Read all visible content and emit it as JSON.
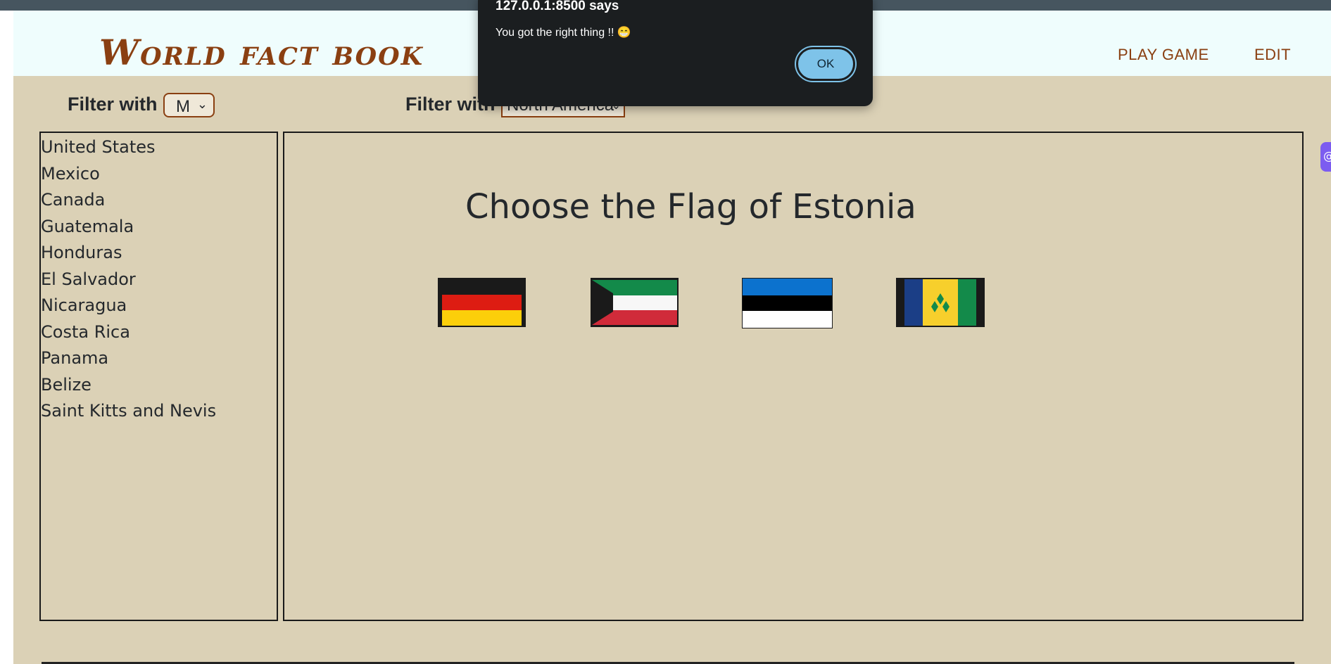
{
  "header": {
    "logo": "World fact book",
    "nav": {
      "play_game": "PLAY GAME",
      "edit": "EDIT"
    }
  },
  "filters": {
    "letter": {
      "label": "Filter with",
      "selected": "M"
    },
    "region": {
      "label": "Filter with",
      "selected": "North America"
    }
  },
  "countries": [
    "United States",
    "Mexico",
    "Canada",
    "Guatemala",
    "Honduras",
    "El Salvador",
    "Nicaragua",
    "Costa Rica",
    "Panama",
    "Belize",
    "Saint Kitts and Nevis"
  ],
  "game": {
    "title": "Choose the Flag of Estonia",
    "flags": [
      "germany-flag",
      "kuwait-flag",
      "estonia-flag",
      "saint-vincent-flag"
    ]
  },
  "dialog": {
    "title": "127.0.0.1:8500 says",
    "message": "You got the right thing !! 😁",
    "ok_label": "OK"
  },
  "colors": {
    "page_bg": "#dbd1b6",
    "header_bg": "#effdfd",
    "brand": "#8a3f11",
    "dialog_bg": "#1b1e20",
    "ok_button": "#7ec3e9"
  }
}
